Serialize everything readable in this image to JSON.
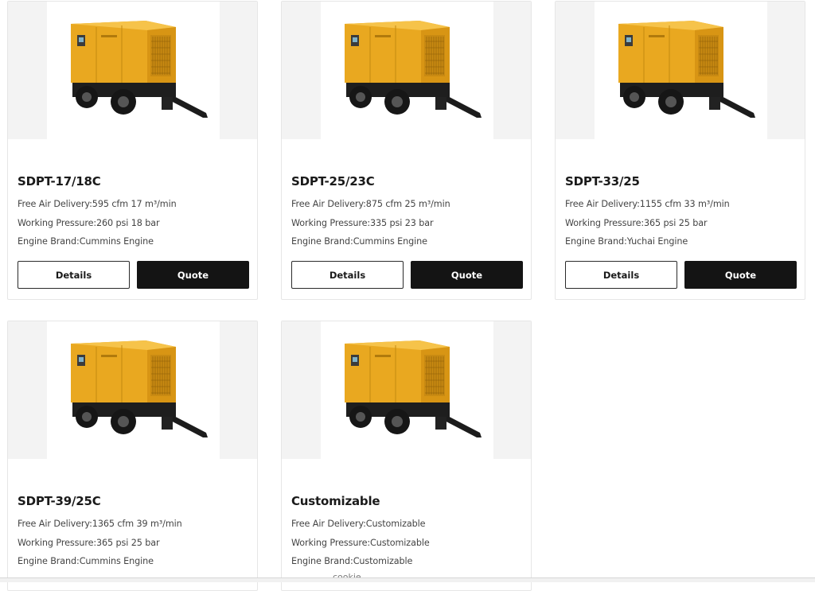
{
  "products": [
    {
      "title": "SDPT-17/18C",
      "spec_air": "Free Air Delivery:595 cfm 17 m³/min",
      "spec_pressure": "Working Pressure:260 psi 18 bar",
      "spec_engine": "Engine Brand:Cummins Engine",
      "details_label": "Details",
      "quote_label": "Quote"
    },
    {
      "title": "SDPT-25/23C",
      "spec_air": "Free Air Delivery:875 cfm 25 m³/min",
      "spec_pressure": "Working Pressure:335 psi 23 bar",
      "spec_engine": "Engine Brand:Cummins Engine",
      "details_label": "Details",
      "quote_label": "Quote"
    },
    {
      "title": "SDPT-33/25",
      "spec_air": "Free Air Delivery:1155 cfm 33 m³/min",
      "spec_pressure": "Working Pressure:365 psi 25 bar",
      "spec_engine": "Engine Brand:Yuchai Engine",
      "details_label": "Details",
      "quote_label": "Quote"
    },
    {
      "title": "SDPT-39/25C",
      "spec_air": "Free Air Delivery:1365 cfm 39 m³/min",
      "spec_pressure": "Working Pressure:365 psi 25 bar",
      "spec_engine": "Engine Brand:Cummins Engine"
    },
    {
      "title": "Customizable",
      "spec_air": "Free Air Delivery:Customizable",
      "spec_pressure": "Working Pressure:Customizable",
      "spec_engine": "Engine Brand:Customizable"
    }
  ],
  "cookie_notice": {
    "text": "cookie"
  },
  "colors": {
    "accent_yellow": "#f0b429",
    "button_dark": "#141414",
    "image_bg": "#f3f3f3"
  },
  "icons": {
    "product_image": "portable-air-compressor-trailer"
  }
}
